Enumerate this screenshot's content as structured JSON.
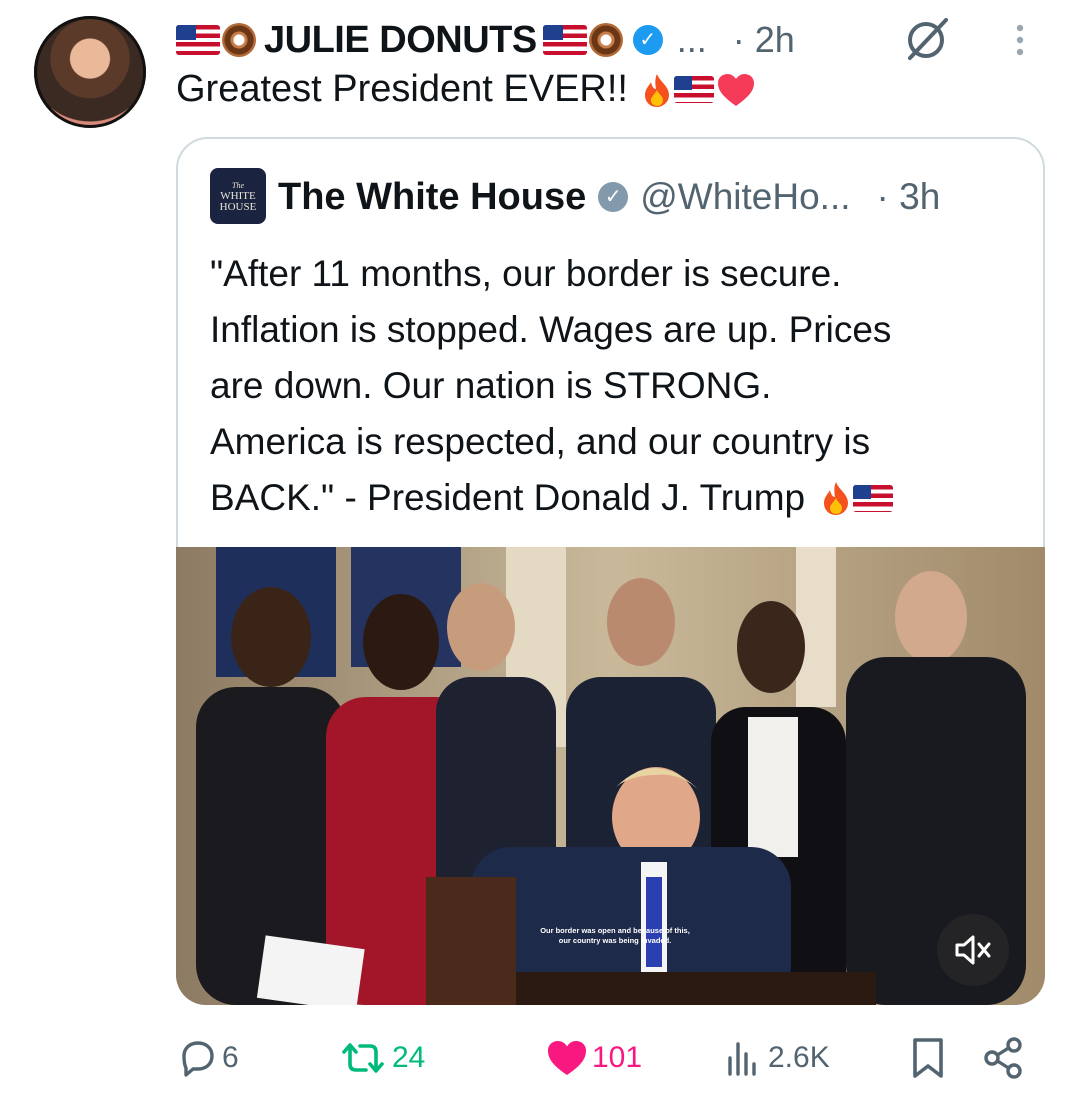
{
  "post": {
    "display_name": "JULIE DONUTS",
    "ellipsis": "...",
    "time": "· 2h",
    "text": "Greatest President EVER!!"
  },
  "quote": {
    "avatar_lines": [
      "The",
      "WHITE",
      "HOUSE"
    ],
    "name": "The White House",
    "handle": "@WhiteHo...",
    "time": "· 3h",
    "lines": [
      "\"After 11 months, our border is secure.",
      "Inflation is stopped. Wages are up. Prices",
      "are down. Our nation is STRONG.",
      "America is respected, and our country is",
      "BACK.\" - President Donald J. Trump"
    ],
    "media": {
      "caption_line1": "Our border was open and because of this,",
      "caption_line2": "our country was being invaded."
    }
  },
  "actions": {
    "replies": "6",
    "reposts": "24",
    "likes": "101",
    "views": "2.6K"
  },
  "colors": {
    "verified_blue": "#1d9bf0",
    "verified_gray": "#829aab",
    "repost_green": "#00ba7c",
    "like_pink": "#f91880",
    "muted_text": "#536471",
    "border": "#cfd9de"
  },
  "icons": [
    "flag-us-icon",
    "donut-icon",
    "verified-badge-icon",
    "grok-icon",
    "more-icon",
    "fire-icon",
    "heart-icon",
    "reply-icon",
    "repost-icon",
    "like-icon",
    "views-icon",
    "bookmark-icon",
    "share-icon",
    "volume-icon"
  ]
}
